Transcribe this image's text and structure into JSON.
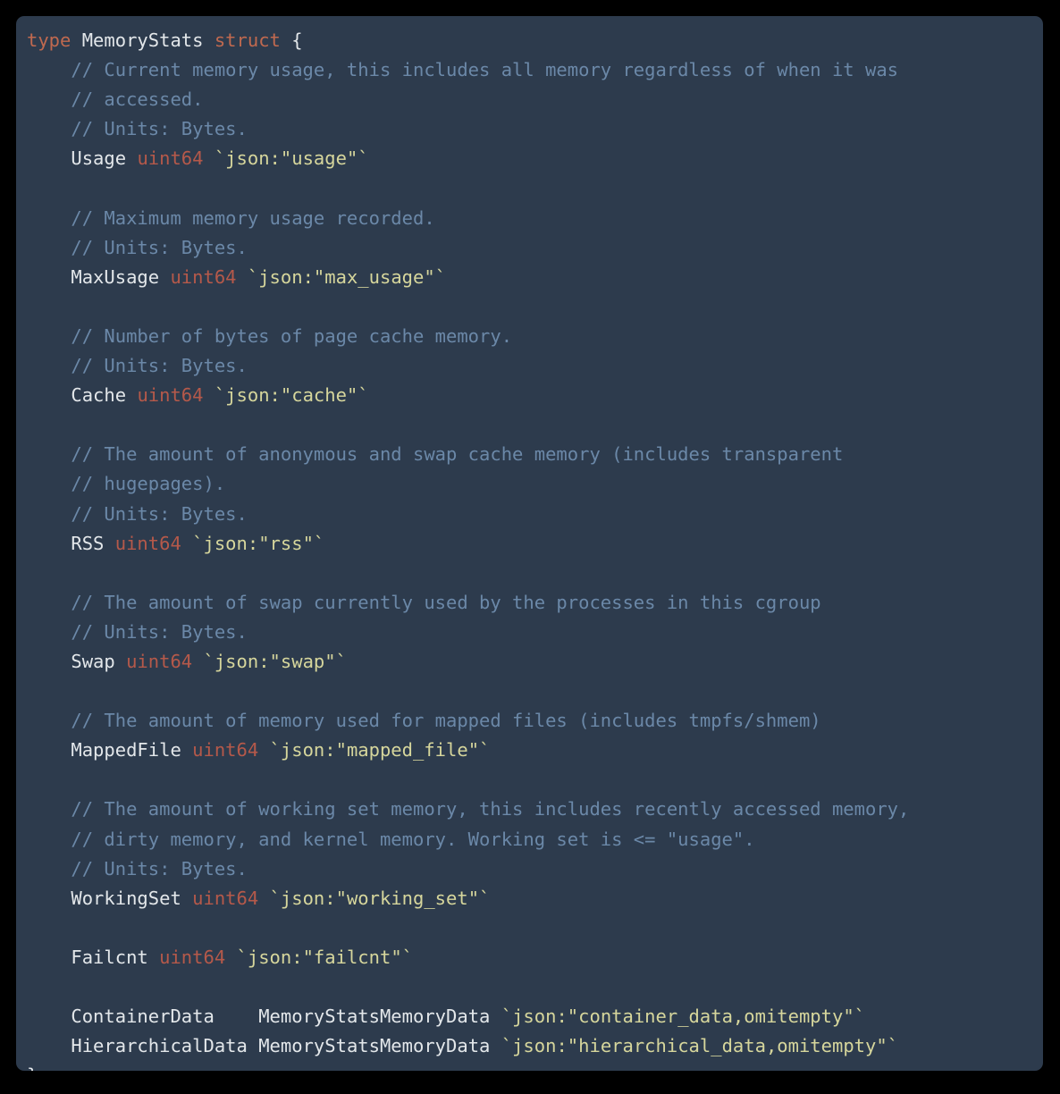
{
  "window": {
    "kind": "code-snippet",
    "language": "go",
    "background_color": "#000000",
    "code_background_color": "#2d3b4d"
  },
  "theme": {
    "keyword_color": "#c0694f",
    "identifier_color": "#e3e7ea",
    "type_color": "#b5594a",
    "struct_tag_color": "#d6d69c",
    "comment_color": "#6b88a8",
    "punctuation_color": "#e3e7ea"
  },
  "code": {
    "title": "type MemoryStats struct",
    "lines": [
      {
        "index": 1,
        "tokens": [
          {
            "cls": "t-kw",
            "text": "type"
          },
          {
            "cls": "t-plain",
            "text": " "
          },
          {
            "cls": "t-id",
            "text": "MemoryStats"
          },
          {
            "cls": "t-plain",
            "text": " "
          },
          {
            "cls": "t-kw",
            "text": "struct"
          },
          {
            "cls": "t-plain",
            "text": " "
          },
          {
            "cls": "t-pun",
            "text": "{"
          }
        ]
      },
      {
        "index": 2,
        "tokens": [
          {
            "cls": "t-cmt",
            "text": "    // Current memory usage, this includes all memory regardless of when it was"
          }
        ]
      },
      {
        "index": 3,
        "tokens": [
          {
            "cls": "t-cmt",
            "text": "    // accessed."
          }
        ]
      },
      {
        "index": 4,
        "tokens": [
          {
            "cls": "t-cmt",
            "text": "    // Units: Bytes."
          }
        ]
      },
      {
        "index": 5,
        "tokens": [
          {
            "cls": "t-plain",
            "text": "    "
          },
          {
            "cls": "t-id",
            "text": "Usage"
          },
          {
            "cls": "t-plain",
            "text": " "
          },
          {
            "cls": "t-typ",
            "text": "uint64"
          },
          {
            "cls": "t-plain",
            "text": " "
          },
          {
            "cls": "t-tag",
            "text": "`json:\"usage\"`"
          }
        ]
      },
      {
        "index": 6,
        "tokens": [
          {
            "cls": "t-plain",
            "text": ""
          }
        ]
      },
      {
        "index": 7,
        "tokens": [
          {
            "cls": "t-cmt",
            "text": "    // Maximum memory usage recorded."
          }
        ]
      },
      {
        "index": 8,
        "tokens": [
          {
            "cls": "t-cmt",
            "text": "    // Units: Bytes."
          }
        ]
      },
      {
        "index": 9,
        "tokens": [
          {
            "cls": "t-plain",
            "text": "    "
          },
          {
            "cls": "t-id",
            "text": "MaxUsage"
          },
          {
            "cls": "t-plain",
            "text": " "
          },
          {
            "cls": "t-typ",
            "text": "uint64"
          },
          {
            "cls": "t-plain",
            "text": " "
          },
          {
            "cls": "t-tag",
            "text": "`json:\"max_usage\"`"
          }
        ]
      },
      {
        "index": 10,
        "tokens": [
          {
            "cls": "t-plain",
            "text": ""
          }
        ]
      },
      {
        "index": 11,
        "tokens": [
          {
            "cls": "t-cmt",
            "text": "    // Number of bytes of page cache memory."
          }
        ]
      },
      {
        "index": 12,
        "tokens": [
          {
            "cls": "t-cmt",
            "text": "    // Units: Bytes."
          }
        ]
      },
      {
        "index": 13,
        "tokens": [
          {
            "cls": "t-plain",
            "text": "    "
          },
          {
            "cls": "t-id",
            "text": "Cache"
          },
          {
            "cls": "t-plain",
            "text": " "
          },
          {
            "cls": "t-typ",
            "text": "uint64"
          },
          {
            "cls": "t-plain",
            "text": " "
          },
          {
            "cls": "t-tag",
            "text": "`json:\"cache\"`"
          }
        ]
      },
      {
        "index": 14,
        "tokens": [
          {
            "cls": "t-plain",
            "text": ""
          }
        ]
      },
      {
        "index": 15,
        "tokens": [
          {
            "cls": "t-cmt",
            "text": "    // The amount of anonymous and swap cache memory (includes transparent"
          }
        ]
      },
      {
        "index": 16,
        "tokens": [
          {
            "cls": "t-cmt",
            "text": "    // hugepages)."
          }
        ]
      },
      {
        "index": 17,
        "tokens": [
          {
            "cls": "t-cmt",
            "text": "    // Units: Bytes."
          }
        ]
      },
      {
        "index": 18,
        "tokens": [
          {
            "cls": "t-plain",
            "text": "    "
          },
          {
            "cls": "t-id",
            "text": "RSS"
          },
          {
            "cls": "t-plain",
            "text": " "
          },
          {
            "cls": "t-typ",
            "text": "uint64"
          },
          {
            "cls": "t-plain",
            "text": " "
          },
          {
            "cls": "t-tag",
            "text": "`json:\"rss\"`"
          }
        ]
      },
      {
        "index": 19,
        "tokens": [
          {
            "cls": "t-plain",
            "text": ""
          }
        ]
      },
      {
        "index": 20,
        "tokens": [
          {
            "cls": "t-cmt",
            "text": "    // The amount of swap currently used by the processes in this cgroup"
          }
        ]
      },
      {
        "index": 21,
        "tokens": [
          {
            "cls": "t-cmt",
            "text": "    // Units: Bytes."
          }
        ]
      },
      {
        "index": 22,
        "tokens": [
          {
            "cls": "t-plain",
            "text": "    "
          },
          {
            "cls": "t-id",
            "text": "Swap"
          },
          {
            "cls": "t-plain",
            "text": " "
          },
          {
            "cls": "t-typ",
            "text": "uint64"
          },
          {
            "cls": "t-plain",
            "text": " "
          },
          {
            "cls": "t-tag",
            "text": "`json:\"swap\"`"
          }
        ]
      },
      {
        "index": 23,
        "tokens": [
          {
            "cls": "t-plain",
            "text": ""
          }
        ]
      },
      {
        "index": 24,
        "tokens": [
          {
            "cls": "t-cmt",
            "text": "    // The amount of memory used for mapped files (includes tmpfs/shmem)"
          }
        ]
      },
      {
        "index": 25,
        "tokens": [
          {
            "cls": "t-plain",
            "text": "    "
          },
          {
            "cls": "t-id",
            "text": "MappedFile"
          },
          {
            "cls": "t-plain",
            "text": " "
          },
          {
            "cls": "t-typ",
            "text": "uint64"
          },
          {
            "cls": "t-plain",
            "text": " "
          },
          {
            "cls": "t-tag",
            "text": "`json:\"mapped_file\"`"
          }
        ]
      },
      {
        "index": 26,
        "tokens": [
          {
            "cls": "t-plain",
            "text": ""
          }
        ]
      },
      {
        "index": 27,
        "tokens": [
          {
            "cls": "t-cmt",
            "text": "    // The amount of working set memory, this includes recently accessed memory,"
          }
        ]
      },
      {
        "index": 28,
        "tokens": [
          {
            "cls": "t-cmt",
            "text": "    // dirty memory, and kernel memory. Working set is <= \"usage\"."
          }
        ]
      },
      {
        "index": 29,
        "tokens": [
          {
            "cls": "t-cmt",
            "text": "    // Units: Bytes."
          }
        ]
      },
      {
        "index": 30,
        "tokens": [
          {
            "cls": "t-plain",
            "text": "    "
          },
          {
            "cls": "t-id",
            "text": "WorkingSet"
          },
          {
            "cls": "t-plain",
            "text": " "
          },
          {
            "cls": "t-typ",
            "text": "uint64"
          },
          {
            "cls": "t-plain",
            "text": " "
          },
          {
            "cls": "t-tag",
            "text": "`json:\"working_set\"`"
          }
        ]
      },
      {
        "index": 31,
        "tokens": [
          {
            "cls": "t-plain",
            "text": ""
          }
        ]
      },
      {
        "index": 32,
        "tokens": [
          {
            "cls": "t-plain",
            "text": "    "
          },
          {
            "cls": "t-id",
            "text": "Failcnt"
          },
          {
            "cls": "t-plain",
            "text": " "
          },
          {
            "cls": "t-typ",
            "text": "uint64"
          },
          {
            "cls": "t-plain",
            "text": " "
          },
          {
            "cls": "t-tag",
            "text": "`json:\"failcnt\"`"
          }
        ]
      },
      {
        "index": 33,
        "tokens": [
          {
            "cls": "t-plain",
            "text": ""
          }
        ]
      },
      {
        "index": 34,
        "tokens": [
          {
            "cls": "t-plain",
            "text": "    "
          },
          {
            "cls": "t-id",
            "text": "ContainerData"
          },
          {
            "cls": "t-plain",
            "text": "    "
          },
          {
            "cls": "t-id",
            "text": "MemoryStatsMemoryData"
          },
          {
            "cls": "t-plain",
            "text": " "
          },
          {
            "cls": "t-tag",
            "text": "`json:\"container_data,omitempty\"`"
          }
        ]
      },
      {
        "index": 35,
        "tokens": [
          {
            "cls": "t-plain",
            "text": "    "
          },
          {
            "cls": "t-id",
            "text": "HierarchicalData"
          },
          {
            "cls": "t-plain",
            "text": " "
          },
          {
            "cls": "t-id",
            "text": "MemoryStatsMemoryData"
          },
          {
            "cls": "t-plain",
            "text": " "
          },
          {
            "cls": "t-tag",
            "text": "`json:\"hierarchical_data,omitempty\"`"
          }
        ]
      },
      {
        "index": 36,
        "tokens": [
          {
            "cls": "t-pun",
            "text": "}"
          }
        ]
      }
    ]
  }
}
